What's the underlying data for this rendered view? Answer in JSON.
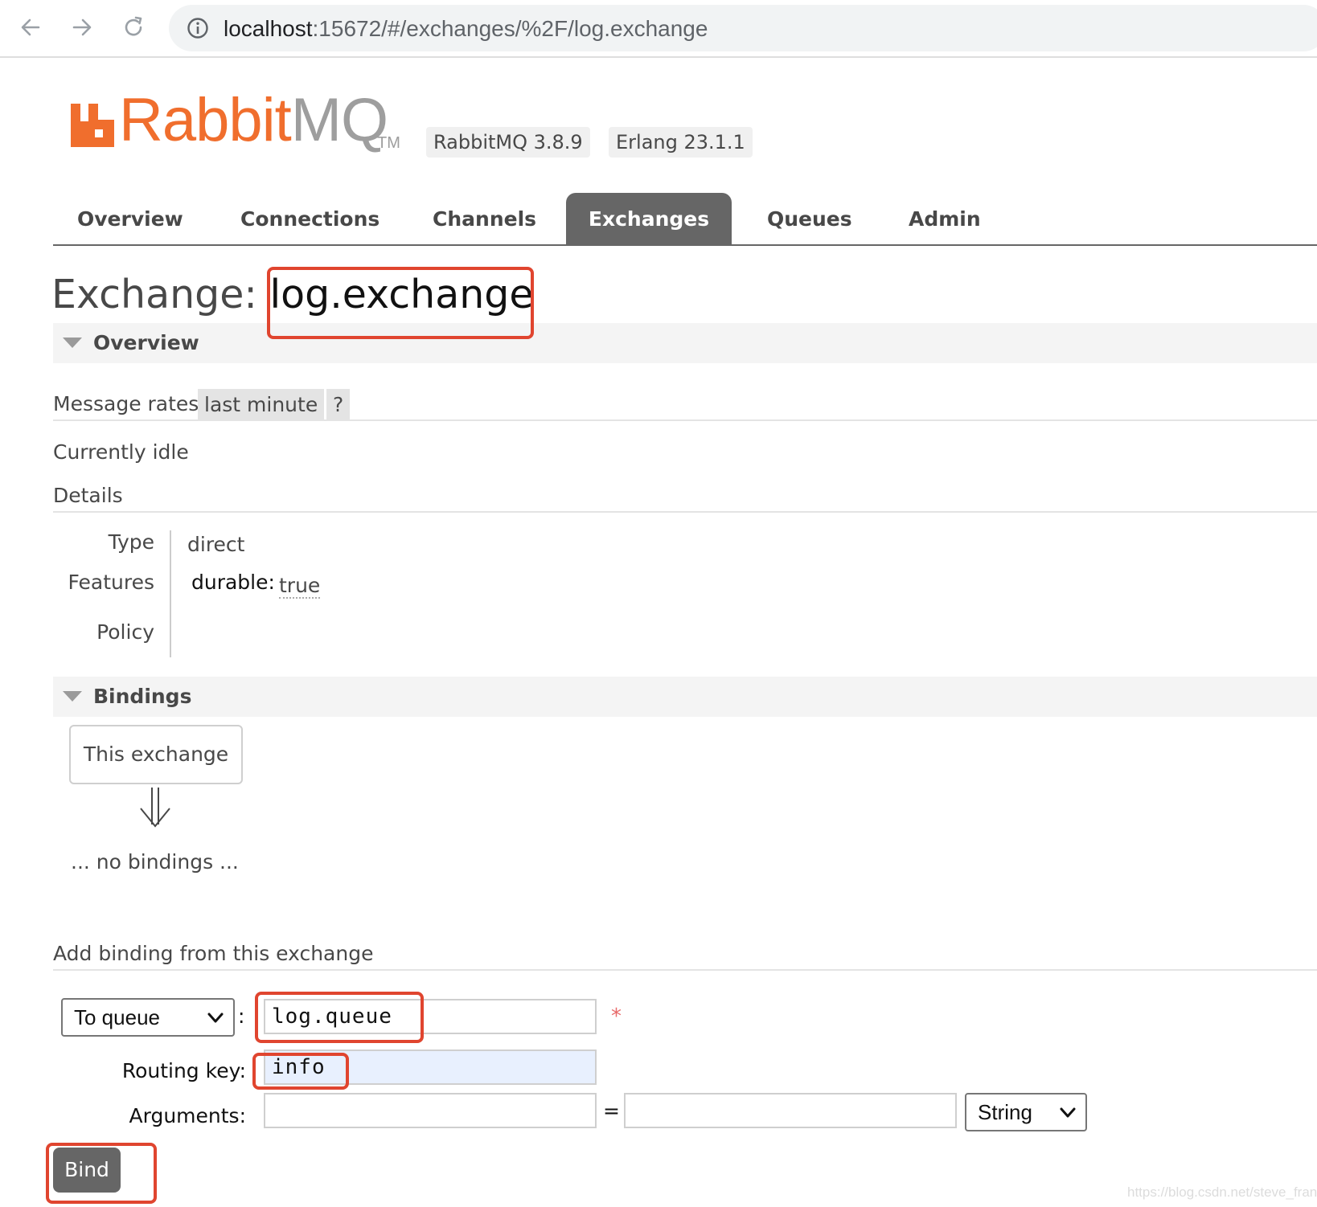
{
  "browser": {
    "url_host": "localhost",
    "url_rest": ":15672/#/exchanges/%2F/log.exchange",
    "icons": [
      "back-icon",
      "forward-icon",
      "reload-icon",
      "info-icon"
    ]
  },
  "header": {
    "logo_rabbit": "Rabbit",
    "logo_mq": "MQ",
    "logo_tm": "TM",
    "version": "RabbitMQ 3.8.9",
    "erlang": "Erlang 23.1.1",
    "brand_color": "#f06e2d"
  },
  "tabs": [
    {
      "label": "Overview"
    },
    {
      "label": "Connections"
    },
    {
      "label": "Channels"
    },
    {
      "label": "Exchanges",
      "active": true
    },
    {
      "label": "Queues"
    },
    {
      "label": "Admin"
    }
  ],
  "page": {
    "title_prefix": "Exchange:",
    "exchange_name": "log.exchange"
  },
  "overview": {
    "section_label": "Overview",
    "message_rates_label": "Message rates",
    "period": "last minute",
    "help": "?",
    "status": "Currently idle",
    "details_label": "Details",
    "type_label": "Type",
    "type_value": "direct",
    "features_label": "Features",
    "durable_key": "durable:",
    "durable_value": "true",
    "policy_label": "Policy"
  },
  "bindings": {
    "section_label": "Bindings",
    "this_exchange": "This exchange",
    "no_bindings": "... no bindings ..."
  },
  "add_binding": {
    "heading": "Add binding from this exchange",
    "destination_type": "To queue",
    "colon": ":",
    "destination_value": "log.queue",
    "required_mark": "*",
    "routing_key_label": "Routing key:",
    "routing_key_value": "info",
    "arguments_label": "Arguments:",
    "equals": "=",
    "arg_type": "String",
    "bind_label": "Bind"
  },
  "watermark": "https://blog.csdn.net/steve_frank",
  "highlight_color": "#e0452f"
}
